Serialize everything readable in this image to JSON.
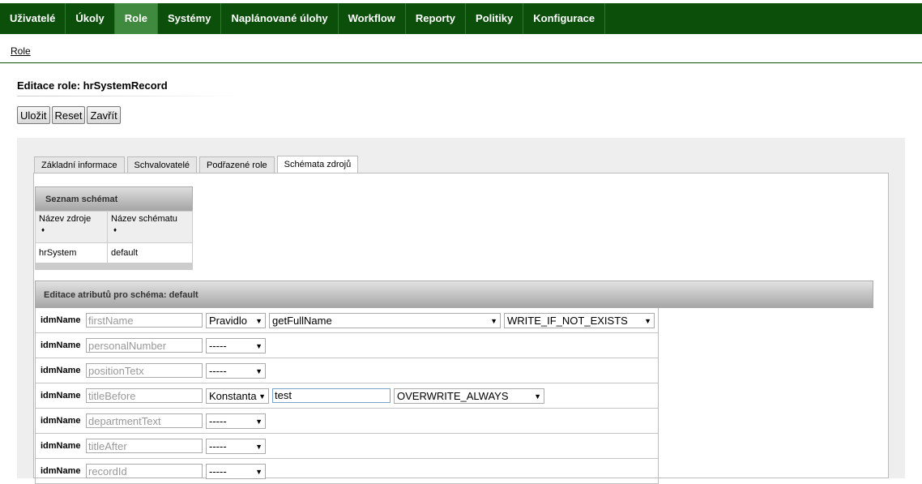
{
  "nav": {
    "items": [
      {
        "label": "Uživatelé"
      },
      {
        "label": "Úkoly"
      },
      {
        "label": "Role"
      },
      {
        "label": "Systémy"
      },
      {
        "label": "Naplánované úlohy"
      },
      {
        "label": "Workflow"
      },
      {
        "label": "Reporty"
      },
      {
        "label": "Politiky"
      },
      {
        "label": "Konfigurace"
      }
    ],
    "active_index": 2
  },
  "breadcrumb": {
    "label": "Role"
  },
  "page": {
    "title": "Editace role: hrSystemRecord"
  },
  "actions": {
    "save": "Uložit",
    "reset": "Reset",
    "close": "Zavřít"
  },
  "tabs": [
    {
      "label": "Základní informace"
    },
    {
      "label": "Schvalovatelé"
    },
    {
      "label": "Podřazené role"
    },
    {
      "label": "Schémata zdrojů"
    }
  ],
  "schema_list": {
    "title": "Seznam schémat",
    "columns": [
      "Název zdroje",
      "Název schématu"
    ],
    "sort_glyph": "♦",
    "rows": [
      {
        "source": "hrSystem",
        "schema": "default"
      }
    ]
  },
  "attributes": {
    "title": "Editace atributů pro schéma: default",
    "rows": [
      {
        "label": "idmName",
        "placeholder": "firstName",
        "type": "Pravidlo",
        "rule": "getFullName",
        "mode": "WRITE_IF_NOT_EXISTS"
      },
      {
        "label": "idmName",
        "placeholder": "personalNumber",
        "type": "-----"
      },
      {
        "label": "idmName",
        "placeholder": "positionTetx",
        "type": "-----"
      },
      {
        "label": "idmName",
        "placeholder": "titleBefore",
        "type": "Konstanta",
        "value": "test",
        "mode": "OVERWRITE_ALWAYS"
      },
      {
        "label": "idmName",
        "placeholder": "departmentText",
        "type": "-----"
      },
      {
        "label": "idmName",
        "placeholder": "titleAfter",
        "type": "-----"
      },
      {
        "label": "idmName",
        "placeholder": "recordId",
        "type": "-----"
      }
    ]
  }
}
